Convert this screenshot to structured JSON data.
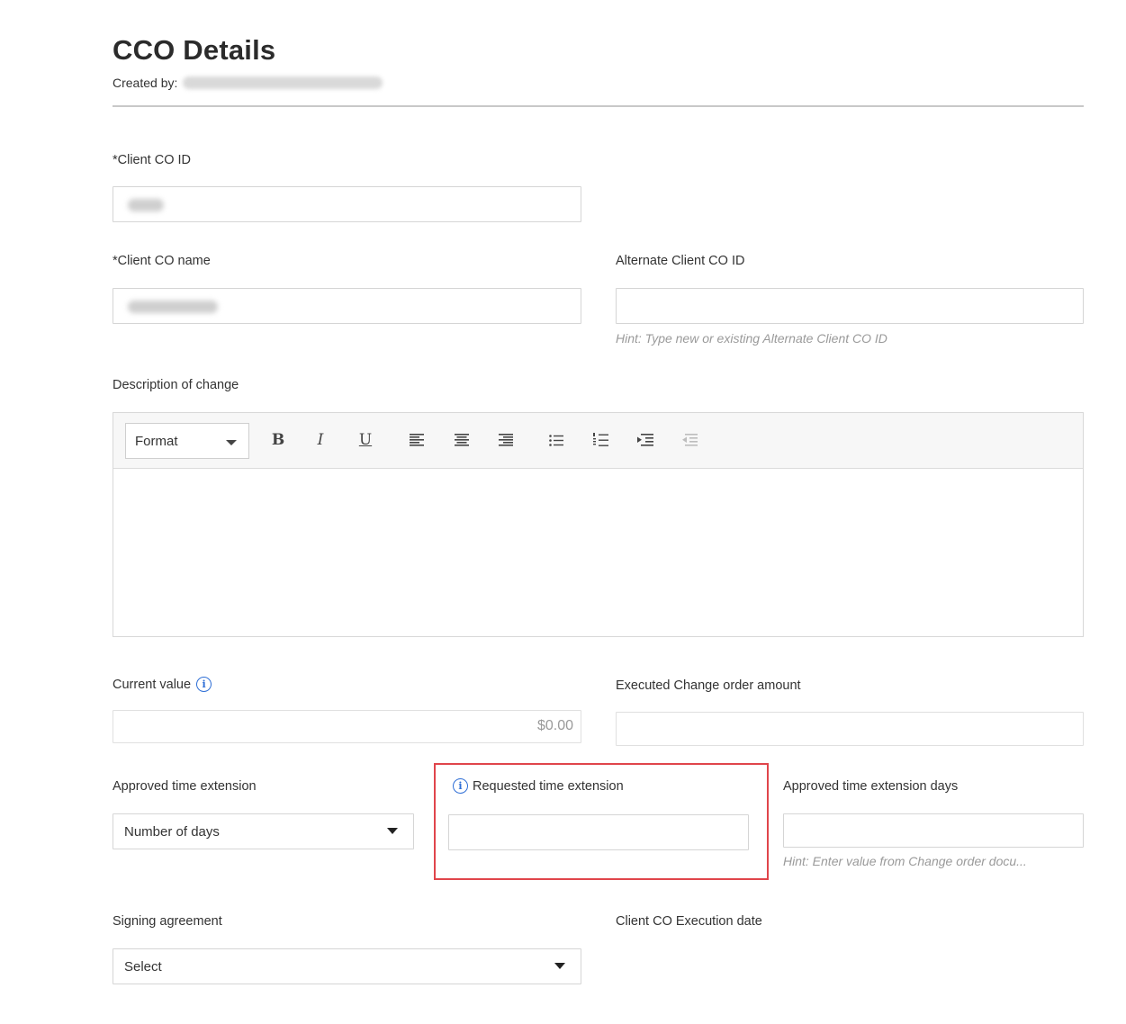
{
  "header": {
    "title": "CCO Details",
    "created_by_label": "Created by:"
  },
  "fields": {
    "client_co_id": {
      "label": "*Client CO ID"
    },
    "client_co_name": {
      "label": "*Client CO name"
    },
    "alternate_client_co_id": {
      "label": "Alternate Client CO ID",
      "hint": "Hint: Type new or existing Alternate Client CO ID"
    },
    "description": {
      "label": "Description of change",
      "format_label": "Format"
    },
    "current_value": {
      "label": "Current value",
      "value": "$0.00"
    },
    "executed_change_order_amount": {
      "label": "Executed Change order amount"
    },
    "approved_time_extension": {
      "label": "Approved time extension",
      "selected": "Number of days"
    },
    "requested_time_extension": {
      "label": "Requested time extension"
    },
    "approved_time_extension_days": {
      "label": "Approved time extension days",
      "hint": "Hint: Enter value from Change order docu..."
    },
    "signing_agreement": {
      "label": "Signing agreement",
      "selected": "Select"
    },
    "client_co_execution_date": {
      "label": "Client CO Execution date"
    }
  },
  "toolbar": {
    "bold": "B",
    "italic": "I",
    "underline": "U"
  },
  "colors": {
    "highlight": "#e0454b",
    "info_icon": "#2f6fd6",
    "hint": "#9a9a9a"
  }
}
